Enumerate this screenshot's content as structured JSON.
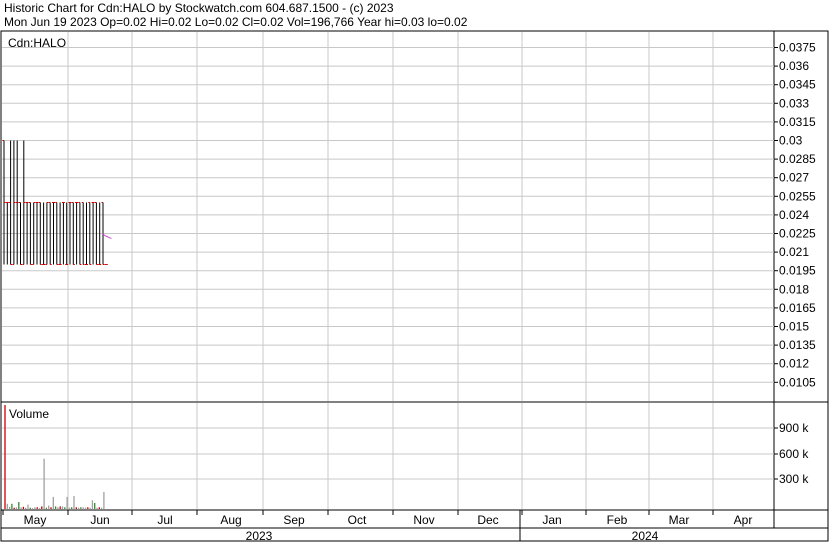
{
  "header": {
    "line1": "Historic Chart for Cdn:HALO by Stockwatch.com 604.687.1500 - (c) 2023",
    "line2": "Mon Jun 19 2023  Op=0.02  Hi=0.02  Lo=0.02  Cl=0.02  Vol=196,766  Year hi=0.03  lo=0.02"
  },
  "colors": {
    "grid": "#c8c8c8",
    "price_bar": "#000000",
    "volume_up": "#2e8b2e",
    "volume_down": "#cc0000",
    "volume_flat": "#a0a0a0",
    "moving_average": "#cc44cc"
  },
  "chart_data": [
    {
      "type": "ohlc",
      "title": "Cdn:HALO",
      "x_months": [
        "May",
        "Jun",
        "Jul",
        "Aug",
        "Sep",
        "Oct",
        "Nov",
        "Dec",
        "Jan",
        "Feb",
        "Mar",
        "Apr"
      ],
      "x_years": [
        "2023",
        "2024"
      ],
      "y_ticks": [
        "0.0375",
        "0.036",
        "0.0345",
        "0.033",
        "0.0315",
        "0.03",
        "0.0285",
        "0.027",
        "0.0255",
        "0.024",
        "0.0225",
        "0.021",
        "0.0195",
        "0.018",
        "0.0165",
        "0.015",
        "0.0135",
        "0.012",
        "0.0105"
      ],
      "ylim": [
        0.0095,
        0.0385
      ],
      "grid": true,
      "bars": [
        {
          "high": 0.03,
          "low": 0.02,
          "open": 0.03,
          "close": 0.025
        },
        {
          "high": 0.025,
          "low": 0.02,
          "open": 0.025,
          "close": 0.025
        },
        {
          "high": 0.03,
          "low": 0.02,
          "open": 0.025,
          "close": 0.02
        },
        {
          "high": 0.03,
          "low": 0.02,
          "open": 0.02,
          "close": 0.025
        },
        {
          "high": 0.03,
          "low": 0.02,
          "open": 0.025,
          "close": 0.025
        },
        {
          "high": 0.025,
          "low": 0.02,
          "open": 0.025,
          "close": 0.02
        },
        {
          "high": 0.03,
          "low": 0.02,
          "open": 0.02,
          "close": 0.025
        },
        {
          "high": 0.025,
          "low": 0.02,
          "open": 0.025,
          "close": 0.025
        },
        {
          "high": 0.025,
          "low": 0.02,
          "open": 0.025,
          "close": 0.02
        },
        {
          "high": 0.025,
          "low": 0.02,
          "open": 0.02,
          "close": 0.025
        },
        {
          "high": 0.025,
          "low": 0.02,
          "open": 0.025,
          "close": 0.025
        },
        {
          "high": 0.025,
          "low": 0.02,
          "open": 0.025,
          "close": 0.02
        },
        {
          "high": 0.025,
          "low": 0.02,
          "open": 0.02,
          "close": 0.02
        },
        {
          "high": 0.025,
          "low": 0.02,
          "open": 0.02,
          "close": 0.025
        },
        {
          "high": 0.025,
          "low": 0.02,
          "open": 0.025,
          "close": 0.02
        },
        {
          "high": 0.025,
          "low": 0.02,
          "open": 0.025,
          "close": 0.025
        },
        {
          "high": 0.025,
          "low": 0.02,
          "open": 0.025,
          "close": 0.02
        },
        {
          "high": 0.025,
          "low": 0.02,
          "open": 0.02,
          "close": 0.02
        },
        {
          "high": 0.025,
          "low": 0.02,
          "open": 0.025,
          "close": 0.025
        },
        {
          "high": 0.025,
          "low": 0.02,
          "open": 0.02,
          "close": 0.02
        },
        {
          "high": 0.025,
          "low": 0.02,
          "open": 0.025,
          "close": 0.025
        },
        {
          "high": 0.025,
          "low": 0.02,
          "open": 0.025,
          "close": 0.02
        },
        {
          "high": 0.025,
          "low": 0.02,
          "open": 0.025,
          "close": 0.025
        },
        {
          "high": 0.025,
          "low": 0.02,
          "open": 0.025,
          "close": 0.02
        },
        {
          "high": 0.025,
          "low": 0.02,
          "open": 0.025,
          "close": 0.02
        },
        {
          "high": 0.025,
          "low": 0.02,
          "open": 0.02,
          "close": 0.02
        },
        {
          "high": 0.025,
          "low": 0.02,
          "open": 0.025,
          "close": 0.02
        },
        {
          "high": 0.025,
          "low": 0.02,
          "open": 0.025,
          "close": 0.025
        },
        {
          "high": 0.025,
          "low": 0.02,
          "open": 0.025,
          "close": 0.02
        },
        {
          "high": 0.025,
          "low": 0.02,
          "open": 0.02,
          "close": 0.02
        },
        {
          "high": 0.025,
          "low": 0.02,
          "open": 0.025,
          "close": 0.02
        },
        {
          "high": 0.02,
          "low": 0.02,
          "open": 0.02,
          "close": 0.02
        }
      ],
      "moving_average": [
        0.0225,
        0.0223,
        0.0222,
        0.0221
      ]
    },
    {
      "type": "bar",
      "title": "Volume",
      "y_ticks": [
        "900 k",
        "600 k",
        "300 k"
      ],
      "ylim": [
        0,
        1200000
      ],
      "values": [
        1200000,
        60000,
        25000,
        60000,
        15000,
        20000,
        80000,
        20000,
        25000,
        15000,
        50000,
        15000,
        10000,
        20000,
        20000,
        10000,
        30000,
        580000,
        15000,
        40000,
        20000,
        140000,
        30000,
        20000,
        30000,
        30000,
        20000,
        140000,
        15000,
        20000,
        150000,
        20000,
        15000,
        20000,
        20000,
        15000,
        20000,
        15000,
        100000,
        70000,
        15000,
        20000,
        15000,
        196766
      ],
      "colors": [
        "down",
        "flat",
        "flat",
        "up",
        "down",
        "flat",
        "up",
        "flat",
        "down",
        "flat",
        "flat",
        "up",
        "flat",
        "flat",
        "down",
        "flat",
        "down",
        "flat",
        "up",
        "flat",
        "down",
        "flat",
        "up",
        "flat",
        "down",
        "flat",
        "up",
        "flat",
        "flat",
        "up",
        "flat",
        "down",
        "flat",
        "up",
        "flat",
        "flat",
        "down",
        "flat",
        "flat",
        "up",
        "flat",
        "down",
        "flat",
        "flat"
      ]
    }
  ]
}
